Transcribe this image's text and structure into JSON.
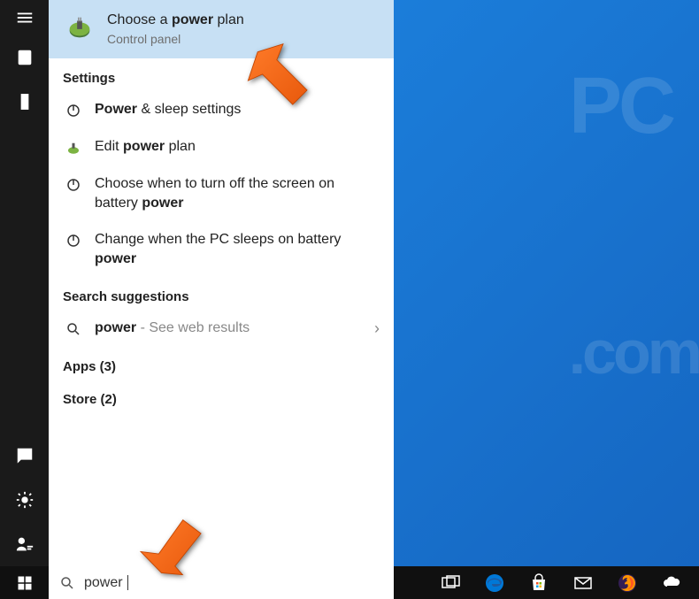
{
  "bestMatch": {
    "title_pre": "Choose a ",
    "title_bold": "power",
    "title_post": " plan",
    "subtitle": "Control panel"
  },
  "sections": {
    "settings": "Settings",
    "suggestions": "Search suggestions",
    "apps": "Apps (3)",
    "store": "Store (2)"
  },
  "results": {
    "r1_bold": "Power",
    "r1_post": " & sleep settings",
    "r2_pre": "Edit ",
    "r2_bold": "power",
    "r2_post": " plan",
    "r3_pre": "Choose when to turn off the screen on battery ",
    "r3_bold": "power",
    "r4_pre": "Change when the PC sleeps on battery ",
    "r4_bold": "power",
    "sugg_bold": "power",
    "sugg_post": " - See web results"
  },
  "search": {
    "value": "power"
  }
}
